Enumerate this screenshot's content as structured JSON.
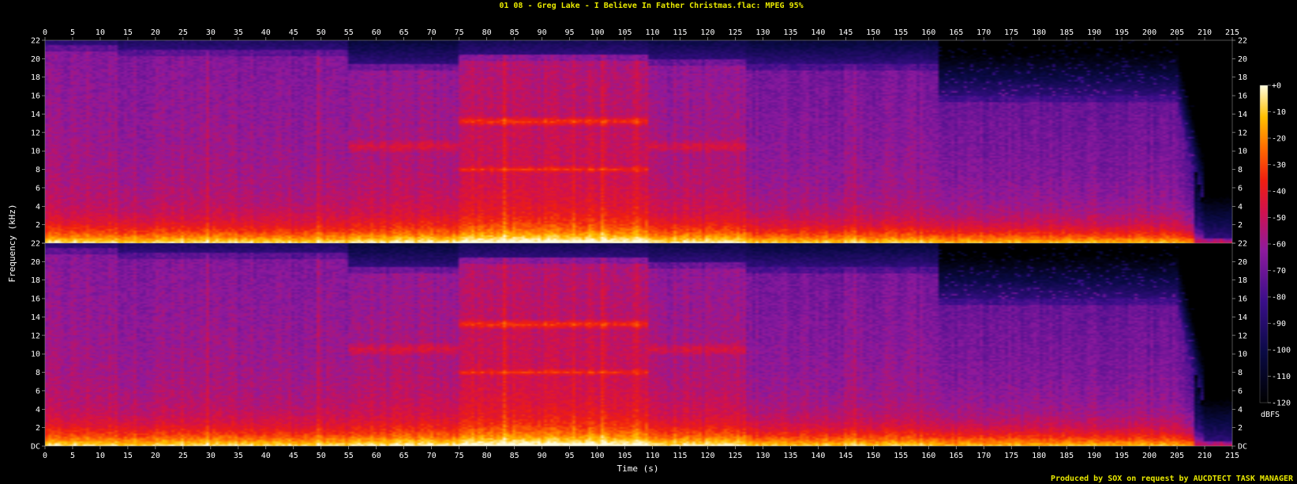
{
  "chart_data": {
    "type": "heatmap",
    "title": "01 08 - Greg Lake - I Believe In Father Christmas.flac: MPEG 95%",
    "xlabel": "Time (s)",
    "ylabel": "Frequency (kHz)",
    "footer": "Produced by SOX on request by AUCDTECT TASK MANAGER",
    "xlim": [
      0,
      215
    ],
    "ylim": [
      0,
      22
    ],
    "x_ticks": [
      "0",
      "5",
      "10",
      "15",
      "20",
      "25",
      "30",
      "35",
      "40",
      "45",
      "50",
      "55",
      "60",
      "65",
      "70",
      "75",
      "80",
      "85",
      "90",
      "95",
      "100",
      "105",
      "110",
      "115",
      "120",
      "125",
      "130",
      "135",
      "140",
      "145",
      "150",
      "155",
      "160",
      "165",
      "170",
      "175",
      "180",
      "185",
      "190",
      "195",
      "200",
      "205",
      "210",
      "215"
    ],
    "y_ticks": [
      "DC",
      "2",
      "4",
      "6",
      "8",
      "10",
      "12",
      "14",
      "16",
      "18",
      "20",
      "22"
    ],
    "channels": 2,
    "colorbar": {
      "label": "dBFS",
      "ticks": [
        "+0",
        "-10",
        "-20",
        "-30",
        "-40",
        "-50",
        "-60",
        "-70",
        "-80",
        "-90",
        "-100",
        "-110",
        "-120"
      ],
      "range": [
        -120,
        0
      ]
    },
    "segments": [
      {
        "t0": 0,
        "t1": 13,
        "cutoff_khz": 21.5,
        "base": 0.56
      },
      {
        "t0": 13,
        "t1": 55,
        "cutoff_khz": 21.0,
        "base": 0.55
      },
      {
        "t0": 55,
        "t1": 75,
        "cutoff_khz": 19.5,
        "base": 0.58
      },
      {
        "t0": 75,
        "t1": 109,
        "cutoff_khz": 20.5,
        "base": 0.64
      },
      {
        "t0": 109,
        "t1": 127,
        "cutoff_khz": 20.0,
        "base": 0.58
      },
      {
        "t0": 127,
        "t1": 162,
        "cutoff_khz": 19.5,
        "base": 0.53
      },
      {
        "t0": 162,
        "t1": 208,
        "cutoff_khz": 16.0,
        "base": 0.5
      },
      {
        "t0": 208,
        "t1": 215,
        "cutoff_khz": 0.5,
        "base": 0.25
      }
    ],
    "bands": [
      {
        "t0": 55,
        "t1": 75,
        "f": 10.5,
        "w": 0.8,
        "boost": 0.1
      },
      {
        "t0": 75,
        "t1": 109,
        "f": 13.2,
        "w": 0.6,
        "boost": 0.16
      },
      {
        "t0": 75,
        "t1": 109,
        "f": 8.0,
        "w": 0.4,
        "boost": 0.12
      },
      {
        "t0": 109,
        "t1": 127,
        "f": 10.5,
        "w": 0.8,
        "boost": 0.1
      }
    ]
  }
}
